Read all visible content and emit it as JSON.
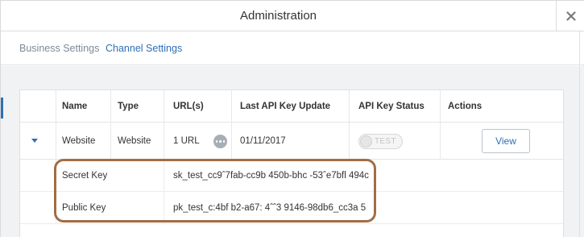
{
  "header": {
    "title": "Administration"
  },
  "tabs": [
    {
      "label": "Business Settings",
      "active": false
    },
    {
      "label": "Channel Settings",
      "active": true
    }
  ],
  "table": {
    "columns": [
      "Name",
      "Type",
      "URL(s)",
      "Last API Key Update",
      "API Key Status",
      "Actions"
    ],
    "row": {
      "name": "Website",
      "type": "Website",
      "urls": "1 URL",
      "last_update": "01/11/2017",
      "status_label": "TEST",
      "action_label": "View"
    },
    "keys": [
      {
        "label": "Secret Key",
        "value": "sk_test_cc9ˆ7fab-cc9b  450b-bhc  -53ˆe7bfl  494c"
      },
      {
        "label": "Public Key",
        "value": "pk_test_c:4bf  b2-a67:  4ˆˆ3  9146-98db6_cc3a  5"
      }
    ]
  },
  "colors": {
    "accent": "#2f6fb5",
    "highlight": "#a26d45",
    "muted_tab": "#7c8a99",
    "background": "#f1f2f3"
  },
  "icons": {
    "close": "close-icon",
    "expand": "caret-down-icon",
    "more": "more-dots-icon"
  }
}
